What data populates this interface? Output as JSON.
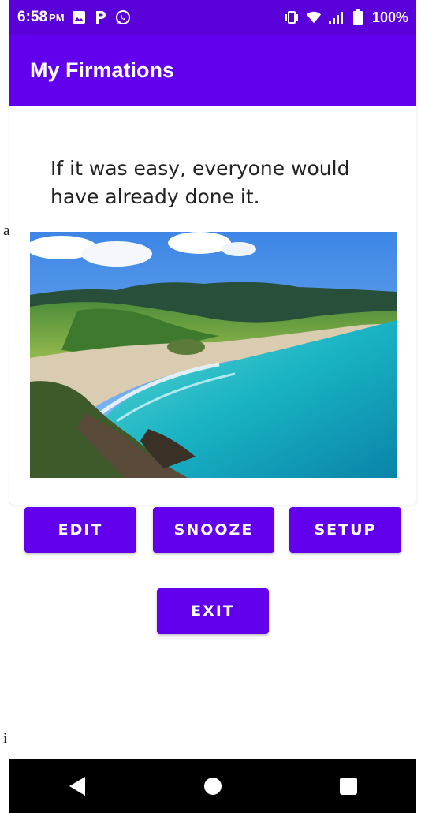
{
  "status_bar": {
    "time": "6:58",
    "ampm": "PM",
    "battery": "100%",
    "icons_left": [
      "image-icon",
      "parking-icon",
      "whatsapp-icon"
    ],
    "icons_right": [
      "vibrate-icon",
      "wifi-icon",
      "signal-icon",
      "battery-icon"
    ]
  },
  "app_bar": {
    "title": "My Firmations"
  },
  "quote": {
    "text": "If it was easy, everyone would have already done it."
  },
  "stray_text": {
    "a": "a",
    "i": "i"
  },
  "buttons": {
    "edit": "EDIT",
    "snooze": "SNOOZE",
    "setup": "SETUP",
    "exit": "EXIT"
  },
  "nav": {
    "icons": [
      "back-icon",
      "home-icon",
      "recents-icon"
    ]
  },
  "colors": {
    "status_bar": "#5a00d8",
    "app_bar": "#6200ee",
    "button": "#6200ee",
    "nav_bar": "#000000"
  }
}
